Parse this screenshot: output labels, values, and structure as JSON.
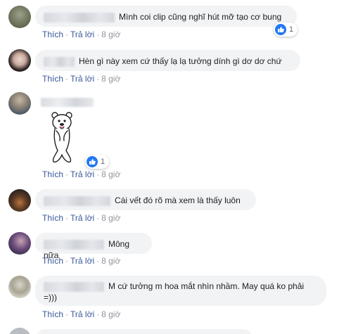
{
  "actions": {
    "like": "Thích",
    "reply": "Trả lời",
    "separator": "·"
  },
  "comments": [
    {
      "text": "Mình coi clip cũng nghĩ hút mỡ tạo cơ bung",
      "time": "8 giờ",
      "reactions": "1"
    },
    {
      "text": "Hèn gì này xem cứ thấy lạ lạ tưởng dính gì dơ dơ chứ",
      "time": "8 giờ"
    },
    {
      "text": "",
      "time": "8 giờ",
      "reactions": "1",
      "sticker": "bear-sticker"
    },
    {
      "text": "Cái vết đó rõ mà xem là thấy luôn",
      "time": "8 giờ"
    },
    {
      "text": "Mông nữa",
      "time": "8 giờ"
    },
    {
      "text": "M cứ tưởng m hoa mắt nhìn nhầm. May quá ko phải =)))",
      "time": "8 giờ"
    }
  ],
  "colors": {
    "link": "#385898",
    "bubble": "#f2f3f5",
    "like": "#2078f4"
  }
}
